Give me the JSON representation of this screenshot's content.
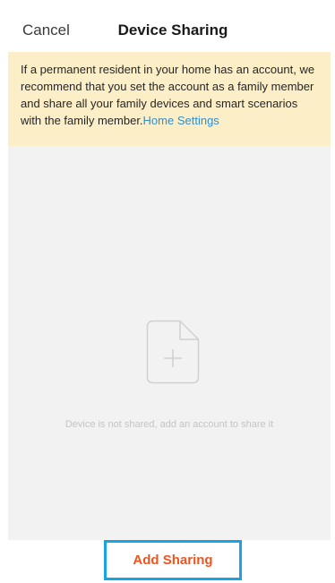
{
  "nav": {
    "cancel_label": "Cancel",
    "title": "Device Sharing"
  },
  "notice": {
    "text": "If a permanent resident in your home has an account, we recommend that you set the account as a family member and share all your family devices and smart scenarios with the family member.",
    "link_label": "Home Settings"
  },
  "empty_state": {
    "icon": "add-file-icon",
    "message": "Device is not shared, add an account to share it"
  },
  "footer": {
    "add_sharing_label": "Add Sharing"
  },
  "colors": {
    "notice_background": "#fcefc7",
    "link": "#2c8fd6",
    "button_text": "#f0541f",
    "button_border": "#18a3e1",
    "content_background": "#f2f2f2"
  }
}
